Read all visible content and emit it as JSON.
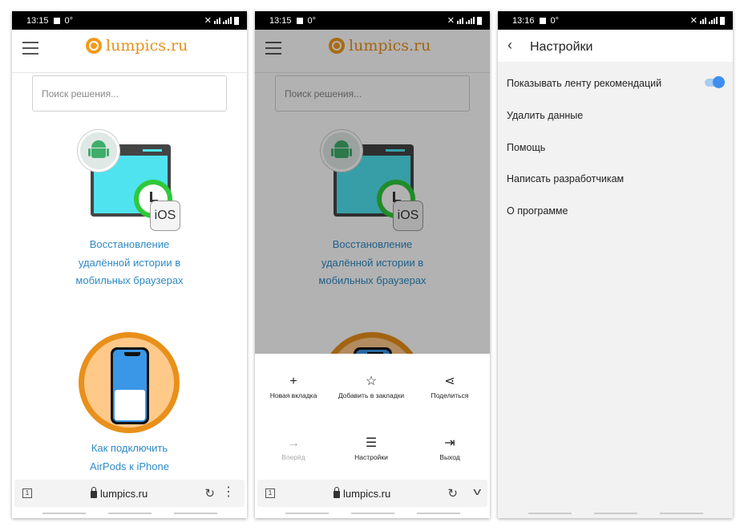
{
  "status_bars": [
    {
      "time": "13:15",
      "extra": "0°"
    },
    {
      "time": "13:15",
      "extra": "0°"
    },
    {
      "time": "13:16",
      "extra": "0°"
    }
  ],
  "site": {
    "logo_text": "lumpics.ru",
    "search_placeholder": "Поиск решения...",
    "articles": [
      {
        "title": "Восстановление удалённой истории в мобильных браузерах"
      },
      {
        "title": "Как подключить AirPods к iPhone"
      }
    ],
    "illustration_badge": "iOS"
  },
  "address_bar": {
    "tab_count": "1",
    "url": "lumpics.ru"
  },
  "browser_menu": {
    "items": [
      {
        "label": "Новая вкладка",
        "icon": "plus-icon",
        "enabled": true
      },
      {
        "label": "Добавить в закладки",
        "icon": "star-icon",
        "enabled": true
      },
      {
        "label": "Поделиться",
        "icon": "share-icon",
        "enabled": true
      },
      {
        "label": "Вперёд",
        "icon": "arrow-forward-icon",
        "enabled": false
      },
      {
        "label": "Настройки",
        "icon": "sliders-icon",
        "enabled": true
      },
      {
        "label": "Выход",
        "icon": "exit-icon",
        "enabled": true
      }
    ]
  },
  "settings": {
    "title": "Настройки",
    "rows": [
      {
        "label": "Показывать ленту рекомендаций",
        "toggle": true
      },
      {
        "label": "Удалить данные"
      },
      {
        "label": "Помощь"
      },
      {
        "label": "Написать разработчикам"
      },
      {
        "label": "О программе"
      }
    ]
  },
  "colors": {
    "accent": "#e8901a",
    "link": "#2f8ac4",
    "toggle_on": "#3d8ff0"
  }
}
